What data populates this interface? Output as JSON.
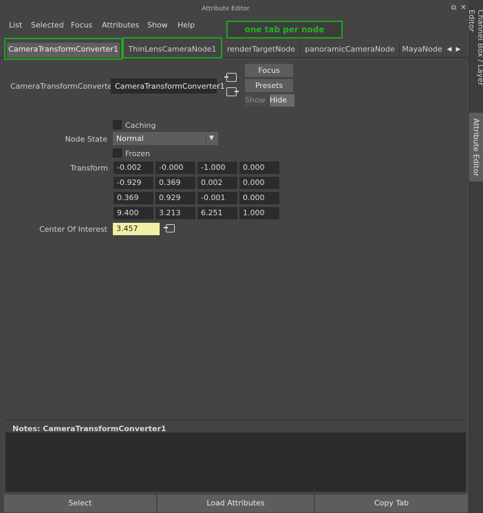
{
  "window": {
    "title": "Attribute Editor",
    "float_icon": "⧉",
    "close_icon": "✕"
  },
  "menu": [
    "List",
    "Selected",
    "Focus",
    "Attributes",
    "Show",
    "Help"
  ],
  "annotation": "one tab per node",
  "tabs": [
    {
      "label": "CameraTransformConverter1",
      "active": true
    },
    {
      "label": "ThinLensCameraNode1",
      "active": false
    },
    {
      "label": "renderTargetNode",
      "active": false
    },
    {
      "label": "panoramicCameraNode",
      "active": false
    },
    {
      "label": "MayaNode",
      "active": false
    }
  ],
  "tab_arrows": {
    "left": "◀",
    "right": "▶"
  },
  "node": {
    "label": "CameraTransformConverter:",
    "name": "CameraTransformConverter1",
    "focus_label": "Focus",
    "presets_label": "Presets",
    "show_label": "Show",
    "hide_label": "Hide"
  },
  "attributes": {
    "caching_label": "Caching",
    "node_state_label": "Node State",
    "node_state_value": "Normal",
    "frozen_label": "Frozen",
    "transform_label": "Transform",
    "transform": [
      [
        "-0.002",
        "-0.000",
        "-1.000",
        "0.000"
      ],
      [
        "-0.929",
        "0.369",
        "0.002",
        "0.000"
      ],
      [
        "0.369",
        "0.929",
        "-0.001",
        "0.000"
      ],
      [
        "9.400",
        "3.213",
        "6.251",
        "1.000"
      ]
    ],
    "coi_label": "Center Of Interest",
    "coi_value": "3.457"
  },
  "notes": {
    "label": "Notes:  CameraTransformConverter1"
  },
  "bottom": {
    "select_label": "Select",
    "load_label": "Load Attributes",
    "copy_label": "Copy Tab"
  },
  "side_tabs": {
    "channel_box": "Channel Box / Layer Editor",
    "attribute_editor": "Attribute Editor"
  },
  "colors": {
    "annotation": "#1fa51f",
    "highlight_field": "#f3f0a6"
  }
}
